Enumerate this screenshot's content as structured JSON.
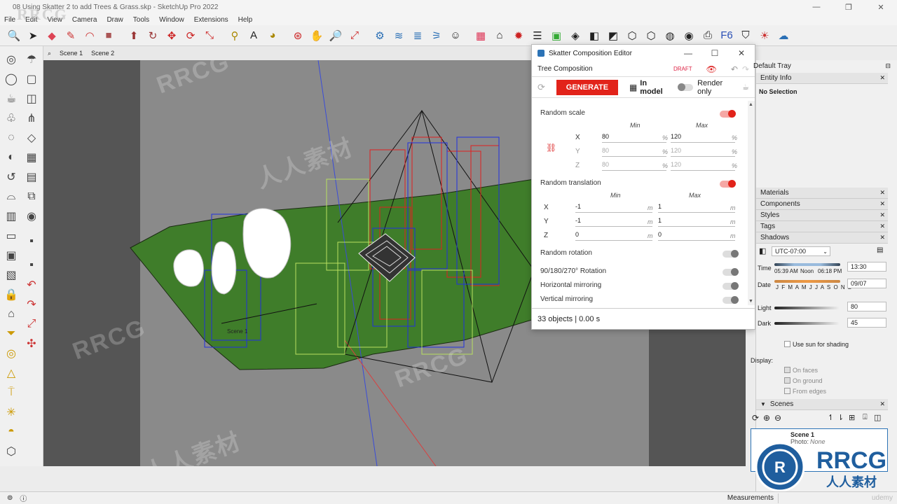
{
  "window": {
    "title": "08 Using Skatter 2 to add Trees & Grass.skp - SketchUp Pro 2022",
    "controls": [
      "—",
      "❐",
      "✕"
    ]
  },
  "menu": [
    "File",
    "Edit",
    "View",
    "Camera",
    "Draw",
    "Tools",
    "Window",
    "Extensions",
    "Help"
  ],
  "scene_tabs": [
    "Scene 1",
    "Scene 2"
  ],
  "viewport": {
    "scene_label": "Scene 1",
    "ground_color": "#3f7d2a",
    "box_colors": [
      "#e02020",
      "#2030e0",
      "#b8e060"
    ]
  },
  "skatter": {
    "title": "Skatter Composition Editor",
    "composition": "Tree Composition",
    "draft": "DRAFT",
    "generate": "GENERATE",
    "in_model": "In model",
    "render_only": "Render only",
    "random_scale": {
      "label": "Random scale",
      "min_label": "Min",
      "max_label": "Max",
      "rows": [
        {
          "axis": "X",
          "min": "80",
          "max": "120",
          "unit": "%"
        },
        {
          "axis": "Y",
          "min": "80",
          "max": "120",
          "unit": "%"
        },
        {
          "axis": "Z",
          "min": "80",
          "max": "120",
          "unit": "%"
        }
      ]
    },
    "random_translation": {
      "label": "Random translation",
      "min_label": "Min",
      "max_label": "Max",
      "rows": [
        {
          "axis": "X",
          "min": "-1",
          "max": "1",
          "unit": "m"
        },
        {
          "axis": "Y",
          "min": "-1",
          "max": "1",
          "unit": "m"
        },
        {
          "axis": "Z",
          "min": "0",
          "max": "0",
          "unit": "m"
        }
      ]
    },
    "random_rotation": "Random rotation",
    "rotation_90": "90/180/270° Rotation",
    "horizontal_mirroring": "Horizontal mirroring",
    "vertical_mirroring": "Vertical mirroring",
    "status": "33 objects | 0.00 s"
  },
  "tray": {
    "title": "Default Tray",
    "entity_info": "Entity Info",
    "no_selection": "No Selection",
    "panels": [
      "Materials",
      "Components",
      "Styles",
      "Tags",
      "Shadows"
    ],
    "timezone": "UTC-07:00",
    "time_label": "Time",
    "sunrise": "05:39 AM",
    "noon": "Noon",
    "sunset": "06:18 PM",
    "time_value": "13:30",
    "date_label": "Date",
    "months": "J F M A M J J A S O N D",
    "date_value": "09/07",
    "light_label": "Light",
    "light_value": "80",
    "dark_label": "Dark",
    "dark_value": "45",
    "use_sun": "Use sun for shading",
    "display": "Display:",
    "on_faces": "On faces",
    "on_ground": "On ground",
    "from_edges": "From edges",
    "scenes": "Scenes",
    "scene_name": "Scene 1",
    "scene_photo": "Photo:",
    "scene_photo_value": "None"
  },
  "statusbar": {
    "measurements": "Measurements",
    "watermark_text": "RRCG",
    "brand": "udemy"
  },
  "watermark": {
    "top_left": "RRCG",
    "logo_main": "RRCG",
    "logo_sub": "人人素材"
  }
}
